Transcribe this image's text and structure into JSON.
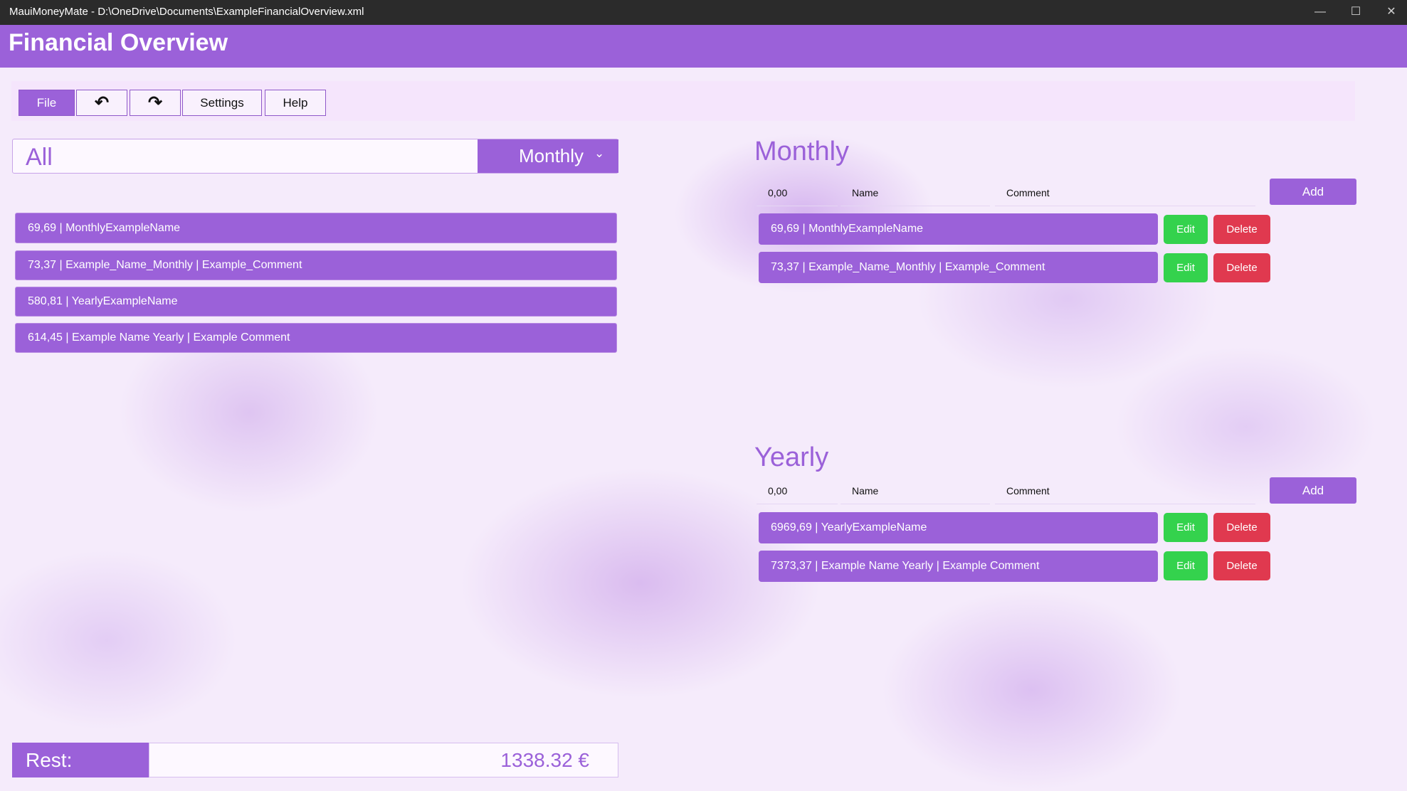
{
  "window": {
    "title": "MauiMoneyMate - D:\\OneDrive\\Documents\\ExampleFinancialOverview.xml",
    "controls": {
      "minimize": "—",
      "maximize": "☐",
      "close": "✕"
    }
  },
  "header": {
    "title": "Financial Overview"
  },
  "toolbar": {
    "file_label": "File",
    "undo_icon": "↶",
    "redo_icon": "↷",
    "settings_label": "Settings",
    "help_label": "Help",
    "active_color": "#9b61d9"
  },
  "filter": {
    "value": "All",
    "period_selected": "Monthly",
    "chevron_icon": "⌄"
  },
  "all_items": [
    "69,69 | MonthlyExampleName",
    "73,37 | Example_Name_Monthly  | Example_Comment",
    "580,81 | YearlyExampleName",
    "614,45 | Example Name Yearly  | Example Comment"
  ],
  "monthly": {
    "title": "Monthly",
    "amount_value": "0,00",
    "name_placeholder": "Name",
    "comment_placeholder": "Comment",
    "add_label": "Add",
    "entries": [
      "69,69 | MonthlyExampleName",
      "73,37 | Example_Name_Monthly  | Example_Comment"
    ]
  },
  "yearly": {
    "title": "Yearly",
    "amount_value": "0,00",
    "name_placeholder": "Name",
    "comment_placeholder": "Comment",
    "add_label": "Add",
    "entries": [
      "6969,69 | YearlyExampleName",
      "7373,37 | Example Name Yearly  | Example Comment"
    ]
  },
  "actions": {
    "edit_label": "Edit",
    "delete_label": "Delete",
    "edit_color": "#34d24d",
    "delete_color": "#e0394f"
  },
  "footer": {
    "rest_label": "Rest:",
    "rest_value": "1338.32 €"
  }
}
